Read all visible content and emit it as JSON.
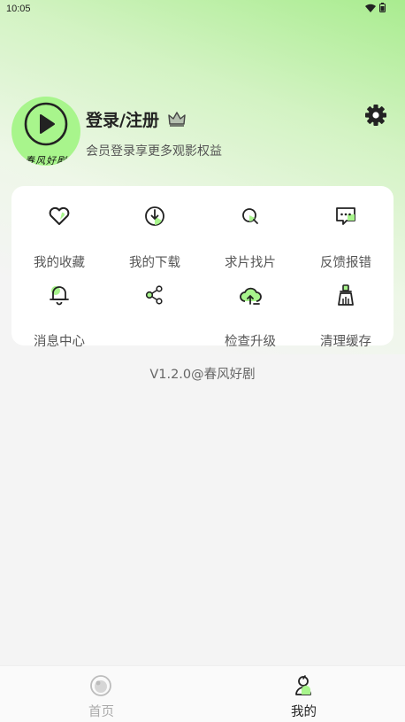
{
  "status_bar": {
    "time": "10:05"
  },
  "profile": {
    "avatar_text": "春风好剧",
    "title": "登录/注册",
    "subtitle": "会员登录享更多观影权益"
  },
  "menu": {
    "items": [
      {
        "label": "我的收藏",
        "icon": "heart-icon"
      },
      {
        "label": "我的下载",
        "icon": "download-icon"
      },
      {
        "label": "求片找片",
        "icon": "search-film-icon"
      },
      {
        "label": "反馈报错",
        "icon": "feedback-icon"
      },
      {
        "label": "消息中心",
        "icon": "bell-icon"
      },
      {
        "label": "",
        "icon": "share-icon"
      },
      {
        "label": "检查升级",
        "icon": "cloud-upload-icon"
      },
      {
        "label": "清理缓存",
        "icon": "broom-icon"
      }
    ]
  },
  "version": "V1.2.0@春风好剧",
  "bottom_nav": {
    "items": [
      {
        "label": "首页",
        "icon": "home-icon",
        "active": false
      },
      {
        "label": "我的",
        "icon": "profile-icon",
        "active": true
      }
    ]
  },
  "colors": {
    "accent": "#a8f58c",
    "active_text": "#222222",
    "inactive_text": "#aaaaaa"
  }
}
